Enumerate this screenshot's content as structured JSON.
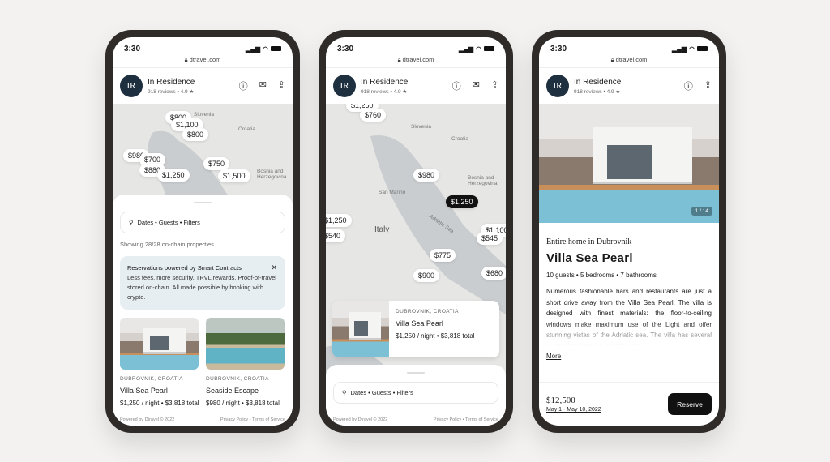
{
  "status": {
    "time": "3:30"
  },
  "browser": {
    "url": "dtravel.com",
    "lock_icon": "lock-icon"
  },
  "host": {
    "initials": "IR",
    "name": "In Residence",
    "meta": "918 reviews • 4.9 ★"
  },
  "header_icons": [
    "info-icon",
    "mail-icon",
    "share-icon"
  ],
  "search": {
    "placeholder": "Dates • Guests • Filters"
  },
  "footer": {
    "powered": "Powered by Dtravel © 2022",
    "links": "Privacy Policy • Terms of Service"
  },
  "map1": {
    "markers": [
      "$800",
      "$1,100",
      "$800",
      "$980",
      "$700",
      "$880",
      "$1,250",
      "$750",
      "$1,500"
    ],
    "labels": [
      "Slovenia",
      "Croatia",
      "Bosnia and Herzegovina"
    ]
  },
  "map2": {
    "markers": [
      "$1,250",
      "$760",
      "$980",
      "$1,250",
      "$1,250",
      "$540",
      "$1,100",
      "$545",
      "$775",
      "$900",
      "$680"
    ],
    "labels": [
      "Slovenia",
      "Croatia",
      "Bosnia and Herzegovina",
      "San Marino",
      "Italy",
      "Adriatic Sea"
    ],
    "selected_index": 3
  },
  "list": {
    "showing": "Showing 28/28 on-chain properties",
    "banner": {
      "title": "Reservations powered by Smart Contracts",
      "body": "Less fees, more security. TRVL rewards. Proof-of-travel stored on-chain. All made possible by booking with crypto.",
      "close": "✕"
    },
    "cards": [
      {
        "location": "DUBROVNIK, CROATIA",
        "title": "Villa Sea Pearl",
        "price": "$1,250  /  night  •  $3,818 total"
      },
      {
        "location": "DUBROVNIK, CROATIA",
        "title": "Seaside Escape",
        "price": "$980 / night • $3,818 total"
      }
    ]
  },
  "map_card": {
    "location": "DUBROVNIK, CROATIA",
    "title": "Villa Sea Pearl",
    "price": "$1,250 / night • $3,818 total"
  },
  "detail": {
    "photo_counter": "1 / 14",
    "kind": "Entire home in Dubrovnik",
    "title": "Villa Sea Pearl",
    "specs": "10 guests • 5 bedrooms • 7 bathrooms",
    "description": "Numerous fashionable bars and restaurants are just a short drive away from the Villa Sea Pearl. The villa is designed with finest materials: the floor-to-ceiling windows make maximum use of the Light and offer stunning vistas of the Adriatic sea. The villa has several levels: the entrance is on the top",
    "more": "More",
    "total": "$12,500",
    "dates": "May 1 - May 10, 2022",
    "reserve": "Reserve"
  }
}
